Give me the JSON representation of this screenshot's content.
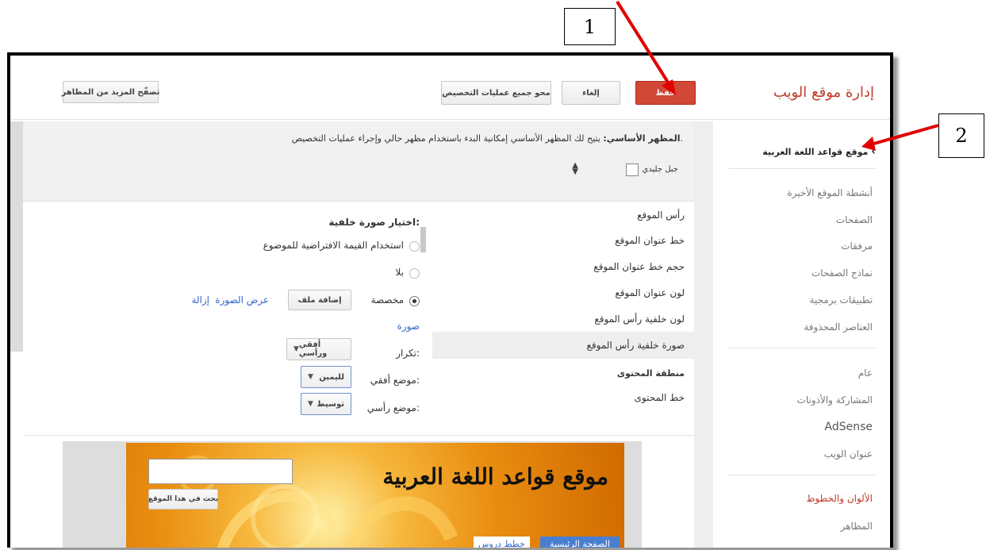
{
  "annotations": {
    "box1": "1",
    "box2": "2"
  },
  "header": {
    "title": "إدارة موقع الويب",
    "save_label": "حفظ",
    "cancel_label": "إلغاء",
    "clear_label": "محو جميع عمليات التخصيص",
    "browse_label": "تصفّح المزيد من المظاهر"
  },
  "sidebar": {
    "site_name": "موقع قواعد اللغة العربية",
    "items": [
      {
        "label": "أنشطة الموقع الأخيرة"
      },
      {
        "label": "الصفحات"
      },
      {
        "label": "مرفقات"
      },
      {
        "label": "نماذج الصفحات"
      },
      {
        "label": "تطبيقات برمجية"
      },
      {
        "label": "العناصر المحذوفة"
      },
      {
        "label": "عام"
      },
      {
        "label": "المشاركة والأذونات"
      },
      {
        "label": "AdSense"
      },
      {
        "label": "عنوان الويب"
      },
      {
        "label": "الألوان والخطوط"
      },
      {
        "label": "المظاهر"
      }
    ]
  },
  "theme": {
    "base_label": "المظهر الأساسي:",
    "base_desc": "يتيح لك المظهر الأساسي إمكانية البدء باستخدام مظهر حالي وإجراء عمليات التخصيص.",
    "theme_name": "جبل جليدي"
  },
  "settings_list": [
    {
      "label": "رأس الموقع",
      "bold": false
    },
    {
      "label": "خط عنوان الموقع"
    },
    {
      "label": "حجم خط عنوان الموقع"
    },
    {
      "label": "لون عنوان الموقع"
    },
    {
      "label": "لون خلفية رأس الموقع"
    },
    {
      "label": "صورة خلفية رأس الموقع",
      "selected": true
    },
    {
      "label": "منطقة المحتوى",
      "bold": true
    },
    {
      "label": "خط المحتوى"
    }
  ],
  "bg_panel": {
    "heading": "اختيار صورة خلفية:",
    "opt_default": "استخدام القيمة الافتراضية للموضوع",
    "opt_none": "بلا",
    "opt_custom": "مخصصة",
    "add_file": "إضافة ملف",
    "view_image": "عرض الصورة",
    "remove": "إزالة",
    "image_label": "صورة",
    "repeat_label": "تكرار:",
    "repeat_value": "أفقي ورأسي",
    "hpos_label": "موضع أفقي:",
    "hpos_value": "لليمين",
    "vpos_label": "موضع رأسي:",
    "vpos_value": "توسيط"
  },
  "preview": {
    "site_title": "موقع قواعد اللغة العربية",
    "search_button": "بحث في هذا الموقع",
    "tab_home": "الصفحة الرئيسية",
    "tab_lessons": "خطط دروس"
  },
  "colors": {
    "accent_red": "#d14836",
    "arrow_red": "#e00000",
    "banner_orange": "#f0a020",
    "link_blue": "#3366cc"
  }
}
